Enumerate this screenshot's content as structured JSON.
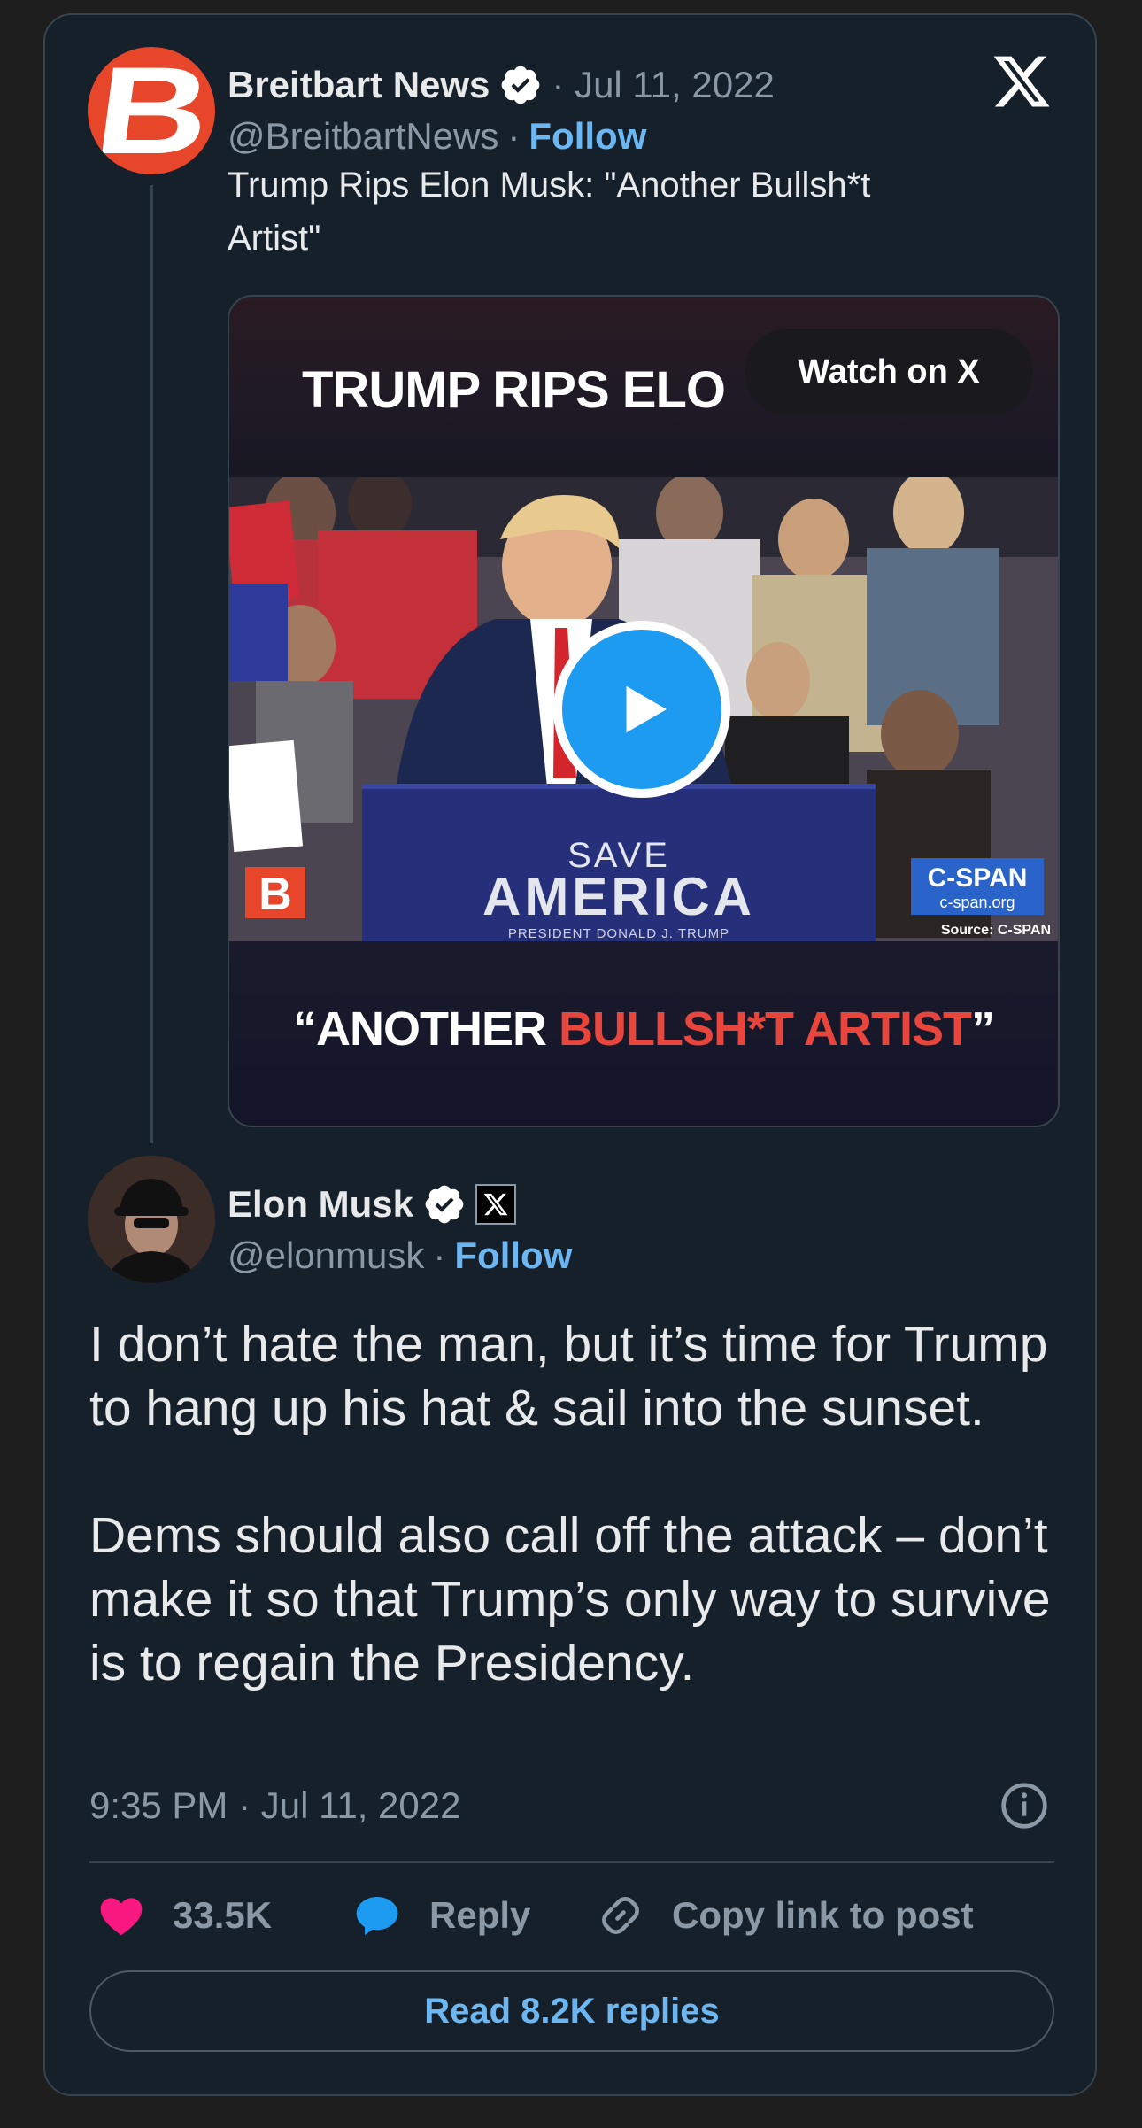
{
  "quoted": {
    "author_name": "Breitbart News",
    "date": "· Jul 11, 2022",
    "handle": "@BreitbartNews",
    "separator": "·",
    "follow_label": "Follow",
    "avatar_letter": "B",
    "text_line1": "Trump Rips Elon Musk:  \"Another Bullsh*t",
    "text_line2": "Artist\"",
    "video": {
      "headline": "TRUMP RIPS ELO",
      "watch_label": "Watch on X",
      "podium_line1": "SAVE",
      "podium_line2": "AMERICA",
      "podium_line3": "PRESIDENT DONALD J. TRUMP",
      "cspan_name": "C-SPAN",
      "cspan_url": "c-span.org",
      "source": "Source: C-SPAN",
      "logo_letter": "B",
      "caption_part1": "“ANOTHER ",
      "caption_part2": "BULLSH*T ARTIST",
      "caption_part3": "”"
    }
  },
  "post": {
    "author_name": "Elon Musk",
    "handle": "@elonmusk",
    "separator": "·",
    "follow_label": "Follow",
    "paragraph1": "I don’t hate the man, but it’s time for Trump to hang up his hat & sail into the sunset.",
    "paragraph2": "Dems should also call off the attack – don’t make it so that Trump’s only way to survive is to regain the Presidency.",
    "timestamp": "9:35 PM · Jul 11, 2022"
  },
  "actions": {
    "likes": "33.5K",
    "reply_label": "Reply",
    "copy_label": "Copy link to post",
    "read_replies_label": "Read 8.2K replies"
  },
  "colors": {
    "card_bg": "#15202b",
    "link": "#6cb6f2",
    "like": "#f91880",
    "reply": "#1d9bf0",
    "brand_red": "#e8462a"
  },
  "icons": [
    "x-logo-icon",
    "verified-badge-icon",
    "play-icon",
    "heart-icon",
    "reply-bubble-icon",
    "link-icon",
    "info-icon"
  ]
}
